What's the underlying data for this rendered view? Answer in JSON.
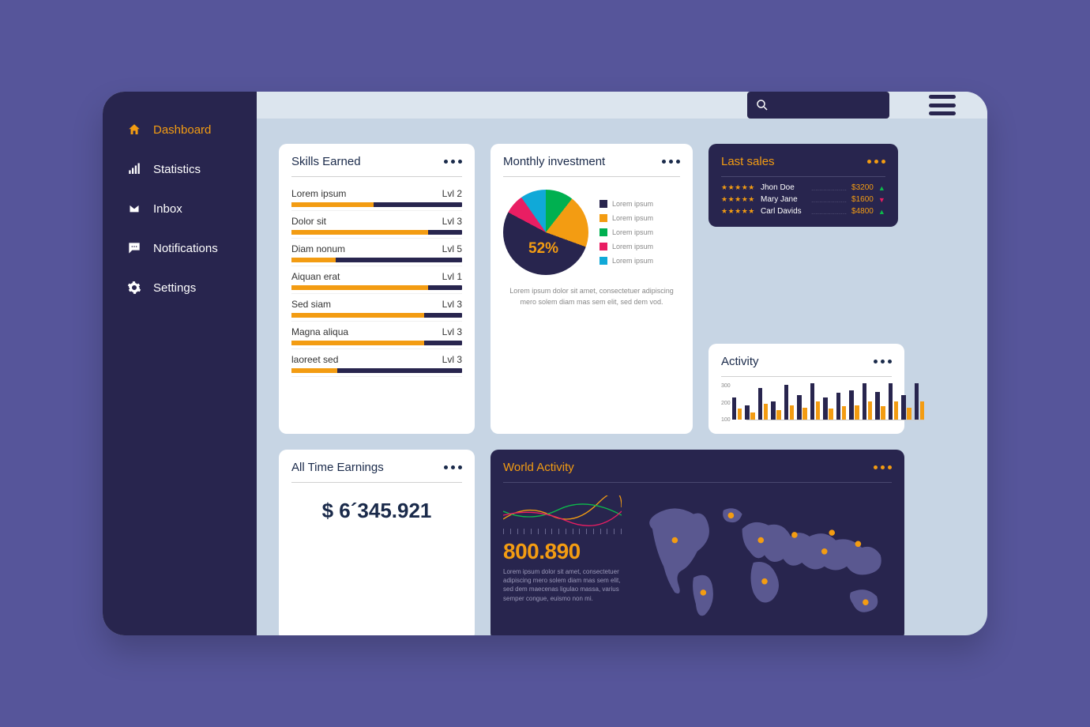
{
  "sidebar": {
    "items": [
      {
        "label": "Dashboard",
        "icon": "home-icon"
      },
      {
        "label": "Statistics",
        "icon": "bars-icon"
      },
      {
        "label": "Inbox",
        "icon": "mail-icon"
      },
      {
        "label": "Notifications",
        "icon": "chat-icon"
      },
      {
        "label": "Settings",
        "icon": "gear-icon"
      }
    ]
  },
  "skills": {
    "title": "Skills Earned",
    "rows": [
      {
        "name": "Lorem ipsum",
        "level": "Lvl 2",
        "pct": 48
      },
      {
        "name": "Dolor sit",
        "level": "Lvl 3",
        "pct": 80
      },
      {
        "name": "Diam nonum",
        "level": "Lvl 5",
        "pct": 26
      },
      {
        "name": "Aiquan erat",
        "level": "Lvl 1",
        "pct": 80
      },
      {
        "name": "Sed siam",
        "level": "Lvl 3",
        "pct": 78
      },
      {
        "name": "Magna aliqua",
        "level": "Lvl 3",
        "pct": 78
      },
      {
        "name": "laoreet sed",
        "level": "Lvl 3",
        "pct": 27
      }
    ]
  },
  "earnings": {
    "title": "All Time Earnings",
    "value": "$ 6´345.921"
  },
  "investment": {
    "title": "Monthly investment",
    "center_label": "52%",
    "legend": [
      {
        "label": "Lorem ipsum",
        "color": "#28254e"
      },
      {
        "label": "Lorem ipsum",
        "color": "#f39c12"
      },
      {
        "label": "Lorem ipsum",
        "color": "#00b050"
      },
      {
        "label": "Lorem ipsum",
        "color": "#e91e63"
      },
      {
        "label": "Lorem ipsum",
        "color": "#10a9d8"
      }
    ],
    "caption": "Lorem ipsum dolor sit amet, consectetuer adipiscing mero solem diam mas sem elit, sed dem vod."
  },
  "sales": {
    "title": "Last sales",
    "rows": [
      {
        "name": "Jhon Doe",
        "amount": "$3200",
        "dir": "up",
        "stars": 5
      },
      {
        "name": "Mary Jane",
        "amount": "$1600",
        "dir": "down",
        "stars": 5
      },
      {
        "name": "Carl Davids",
        "amount": "$4800",
        "dir": "up",
        "stars": 5
      }
    ]
  },
  "activity": {
    "title": "Activity",
    "axis": [
      "300",
      "200",
      "100"
    ]
  },
  "world": {
    "title": "World Activity",
    "number": "800.890",
    "text": "Lorem ipsum dolor sit amet, consectetuer adipiscing mero solem diam mas sem elit, sed dem maecenas ligulao massa, varius semper congue, euismo non mi."
  },
  "chart_data": [
    {
      "type": "pie",
      "title": "Monthly investment",
      "series": [
        {
          "name": "Lorem ipsum",
          "value": 52,
          "color": "#28254e"
        },
        {
          "name": "Lorem ipsum",
          "value": 20,
          "color": "#f39c12"
        },
        {
          "name": "Lorem ipsum",
          "value": 11,
          "color": "#00b050"
        },
        {
          "name": "Lorem ipsum",
          "value": 8,
          "color": "#e91e63"
        },
        {
          "name": "Lorem ipsum",
          "value": 9,
          "color": "#10a9d8"
        }
      ]
    },
    {
      "type": "bar",
      "title": "Activity",
      "ylim": [
        0,
        300
      ],
      "series": [
        {
          "name": "navy",
          "values": [
            180,
            120,
            260,
            150,
            290,
            200,
            300,
            180,
            220,
            240,
            300,
            230,
            300,
            200,
            300
          ]
        },
        {
          "name": "orange",
          "values": [
            90,
            60,
            130,
            80,
            120,
            100,
            150,
            90,
            110,
            120,
            150,
            110,
            150,
            100,
            150
          ]
        }
      ]
    },
    {
      "type": "bar",
      "title": "Skills Earned",
      "categories": [
        "Lorem ipsum",
        "Dolor sit",
        "Diam nonum",
        "Aiquan erat",
        "Sed siam",
        "Magna aliqua",
        "laoreet sed"
      ],
      "values": [
        48,
        80,
        26,
        80,
        78,
        78,
        27
      ],
      "ylim": [
        0,
        100
      ]
    }
  ]
}
